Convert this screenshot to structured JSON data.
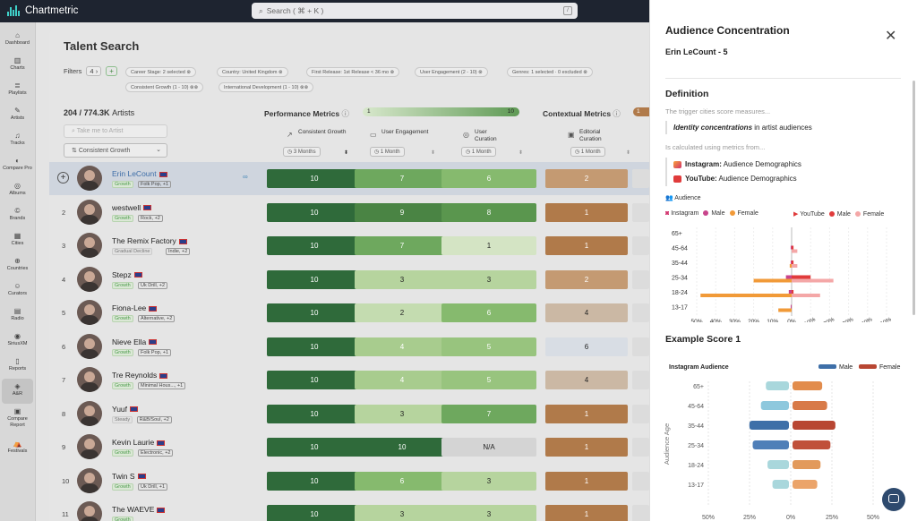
{
  "brand": {
    "name": "Chartmetric"
  },
  "search": {
    "placeholder": "Search ( ⌘ + K )"
  },
  "sidebar": {
    "items": [
      {
        "label": "Dashboard",
        "icon": "home-icon"
      },
      {
        "label": "Charts",
        "icon": "chart-icon"
      },
      {
        "label": "Playlists",
        "icon": "playlist-icon"
      },
      {
        "label": "Artists",
        "icon": "mic-icon"
      },
      {
        "label": "Tracks",
        "icon": "music-icon"
      },
      {
        "label": "Compare Pro",
        "icon": "compare-icon"
      },
      {
        "label": "Albums",
        "icon": "album-icon"
      },
      {
        "label": "Brands",
        "icon": "brand-icon"
      },
      {
        "label": "Cities",
        "icon": "city-icon"
      },
      {
        "label": "Countries",
        "icon": "globe-icon"
      },
      {
        "label": "Curators",
        "icon": "curator-icon"
      },
      {
        "label": "Radio",
        "icon": "radio-icon"
      },
      {
        "label": "SiriusXM",
        "icon": "satellite-icon"
      },
      {
        "label": "Reports",
        "icon": "report-icon"
      },
      {
        "label": "A&R",
        "icon": "ar-icon"
      },
      {
        "label": "Compare Report",
        "icon": "compare-report-icon"
      },
      {
        "label": "Festivals",
        "icon": "festival-icon"
      }
    ]
  },
  "talent": {
    "title": "Talent Search",
    "filters_label": "Filters",
    "filters_count": "4",
    "chips": [
      "Career Stage: 2 selected",
      "Country: United Kingdom",
      "First Release: 1st Release < 36 mo",
      "User Engagement (2 - 10)",
      "Genres: 1 selected · 0 excluded",
      "Consistent Growth (1 - 10)",
      "International Development (1 - 10)"
    ],
    "count": "204 / 774.3K",
    "count_suffix": "Artists",
    "search_placeholder": "Take me to Artist",
    "sort_select": "Consistent Growth",
    "perf_title": "Performance Metrics",
    "perf_min": "1",
    "perf_max": "10",
    "ctx_title": "Contextual Metrics",
    "ctx_min": "1",
    "columns": [
      {
        "title": "Consistent Growth",
        "period": "3 Months"
      },
      {
        "title": "User Engagement",
        "period": "1 Month"
      },
      {
        "title": "User Curation",
        "period": "1 Month"
      },
      {
        "title": "Editorial Curation",
        "period": "1 Month"
      }
    ],
    "rows": [
      {
        "rank": "",
        "name": "Erin LeCount",
        "stage": "Growth",
        "genre": "Folk Pop, +1",
        "scores": [
          "10",
          "7",
          "6",
          "2"
        ]
      },
      {
        "rank": "2",
        "name": "westwell",
        "stage": "Growth",
        "genre": "Rock, +2",
        "scores": [
          "10",
          "9",
          "8",
          "1"
        ]
      },
      {
        "rank": "3",
        "name": "The Remix Factory",
        "stage": "Gradual Decline",
        "genre": "Indie, +2",
        "scores": [
          "10",
          "7",
          "1",
          "1"
        ]
      },
      {
        "rank": "4",
        "name": "Stepz",
        "stage": "Growth",
        "genre": "Uk Drill, +2",
        "scores": [
          "10",
          "3",
          "3",
          "2"
        ]
      },
      {
        "rank": "5",
        "name": "Fiona-Lee",
        "stage": "Growth",
        "genre": "Alternative, +2",
        "scores": [
          "10",
          "2",
          "6",
          "4"
        ]
      },
      {
        "rank": "6",
        "name": "Nieve Ella",
        "stage": "Growth",
        "genre": "Folk Pop, +1",
        "scores": [
          "10",
          "4",
          "5",
          "6"
        ]
      },
      {
        "rank": "7",
        "name": "Tre Reynolds",
        "stage": "Growth",
        "genre": "Minimal Hous..., +1",
        "scores": [
          "10",
          "4",
          "5",
          "4"
        ]
      },
      {
        "rank": "8",
        "name": "Yuuf",
        "stage": "Steady",
        "genre": "R&B/Soul, +2",
        "scores": [
          "10",
          "3",
          "7",
          "1"
        ]
      },
      {
        "rank": "9",
        "name": "Kevin Laurie",
        "stage": "Growth",
        "genre": "Electronic, +2",
        "scores": [
          "10",
          "10",
          "N/A",
          "1"
        ]
      },
      {
        "rank": "10",
        "name": "Twin S",
        "stage": "Growth",
        "genre": "Uk Drill, +1",
        "scores": [
          "10",
          "6",
          "3",
          "1"
        ]
      },
      {
        "rank": "11",
        "name": "The WAEVE",
        "stage": "Growth",
        "genre": "",
        "scores": [
          "10",
          "3",
          "3",
          "1"
        ]
      }
    ]
  },
  "panel": {
    "title": "Audience Concentration",
    "subtitle": "Erin LeCount - 5",
    "def_title": "Definition",
    "def_text": "The trigger cities score measures...",
    "def_emph": "Identity concentrations",
    "def_emph_tail": " in artist audiences",
    "calc_text": "Is calculated using metrics from...",
    "metric1_label": "Instagram:",
    "metric1_value": " Audience Demographics",
    "metric2_label": "YouTube:",
    "metric2_value": " Audience Demographics",
    "audience_label": "Audience",
    "legend": [
      "Instagram",
      "Male",
      "Female",
      "YouTube",
      "Male",
      "Female"
    ],
    "example_title": "Example Score 1"
  },
  "colors": {
    "ig_male": "#c8458c",
    "ig_female": "#f19a38",
    "yt_male": "#e03b3b",
    "yt_female": "#f4a7a7",
    "ex_male": "#3e6fa8",
    "ex_female": "#b84632"
  },
  "chart_data": [
    {
      "type": "bar",
      "orientation": "horizontal-diverging",
      "categories": [
        "65+",
        "45-64",
        "35-44",
        "25-34",
        "18-24",
        "13-17"
      ],
      "xlabel": "",
      "xticks": [
        "50%",
        "40%",
        "30%",
        "20%",
        "10%",
        "0%",
        "10%",
        "20%",
        "30%",
        "40%",
        "50%"
      ],
      "series": [
        {
          "name": "Instagram Male",
          "side": "left",
          "values": [
            0,
            0.5,
            0.5,
            3,
            1.5,
            0.5
          ]
        },
        {
          "name": "Instagram Female",
          "side": "left",
          "values": [
            0,
            0,
            1,
            20,
            48,
            7
          ]
        },
        {
          "name": "YouTube Male",
          "side": "right",
          "values": [
            0,
            1,
            1,
            10,
            1,
            0
          ]
        },
        {
          "name": "YouTube Female",
          "side": "right",
          "values": [
            0,
            3,
            3,
            22,
            15,
            0
          ]
        }
      ]
    },
    {
      "type": "bar",
      "orientation": "horizontal-diverging",
      "title": "Instagram Audience",
      "categories": [
        "65+",
        "45-64",
        "35-44",
        "25-34",
        "18-24",
        "13-17"
      ],
      "ylabel": "Audience Age",
      "xticks": [
        "50%",
        "25%",
        "0%",
        "25%",
        "50%"
      ],
      "series": [
        {
          "name": "Male",
          "side": "left",
          "values": [
            14,
            17,
            24,
            22,
            13,
            10
          ]
        },
        {
          "name": "Female",
          "side": "right",
          "values": [
            18,
            21,
            26,
            23,
            17,
            15
          ]
        }
      ]
    }
  ]
}
